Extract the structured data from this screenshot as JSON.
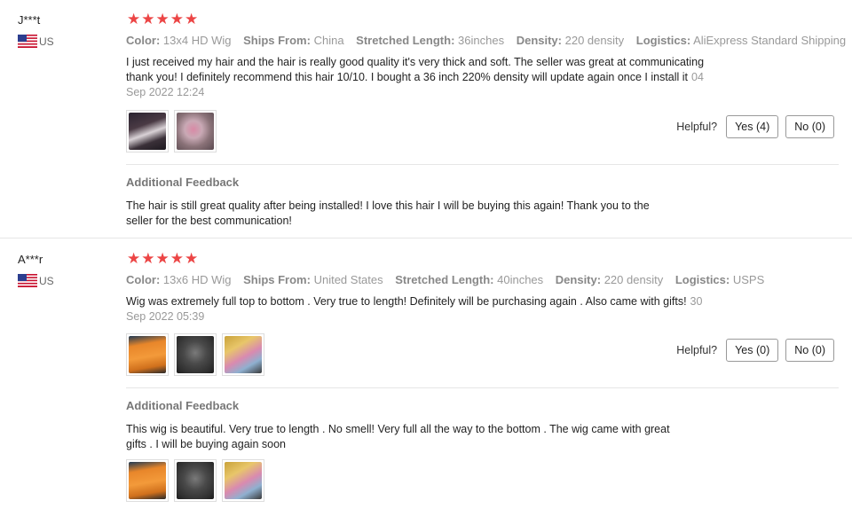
{
  "reviews": [
    {
      "user": {
        "name": "J***t",
        "country": "US"
      },
      "rating": 5,
      "attributes": [
        {
          "label": "Color:",
          "value": "13x4 HD Wig"
        },
        {
          "label": "Ships From:",
          "value": "China"
        },
        {
          "label": "Stretched Length:",
          "value": "36inches"
        },
        {
          "label": "Density:",
          "value": "220 density"
        },
        {
          "label": "Logistics:",
          "value": "AliExpress Standard Shipping"
        }
      ],
      "text_line1": "I just received my hair and the hair is really good quality it's very thick and soft. The seller was great at communicating",
      "text_line2": "thank you! I definitely recommend this hair 10/10. I bought a 36 inch 220% density will update again once I install it",
      "date_part1": "04",
      "date_part2": "Sep 2022 12:24",
      "helpful_label": "Helpful?",
      "yes_label": "Yes (4)",
      "no_label": "No (0)",
      "additional_title": "Additional Feedback",
      "additional_line1": "The hair is still great quality after being installed! I love this hair I will be buying this again! Thank you to the",
      "additional_line2": "seller for the best communication!"
    },
    {
      "user": {
        "name": "A***r",
        "country": "US"
      },
      "rating": 5,
      "attributes": [
        {
          "label": "Color:",
          "value": "13x6 HD Wig"
        },
        {
          "label": "Ships From:",
          "value": "United States"
        },
        {
          "label": "Stretched Length:",
          "value": "40inches"
        },
        {
          "label": "Density:",
          "value": "220 density"
        },
        {
          "label": "Logistics:",
          "value": "USPS"
        }
      ],
      "text_line1": "Wig was extremely full top to bottom . Very true to length! Definitely will be purchasing again . Also came with gifts!",
      "date_part1": "30",
      "date_part2": "Sep 2022 05:39",
      "helpful_label": "Helpful?",
      "yes_label": "Yes (0)",
      "no_label": "No (0)",
      "additional_title": "Additional Feedback",
      "additional_line1": "This wig is beautiful. Very true to length . No smell! Very full all the way to the bottom . The wig came with great",
      "additional_line2": "gifts . I will be buying again soon"
    }
  ],
  "colors": {
    "star": "#ec4545",
    "muted": "#999999"
  }
}
